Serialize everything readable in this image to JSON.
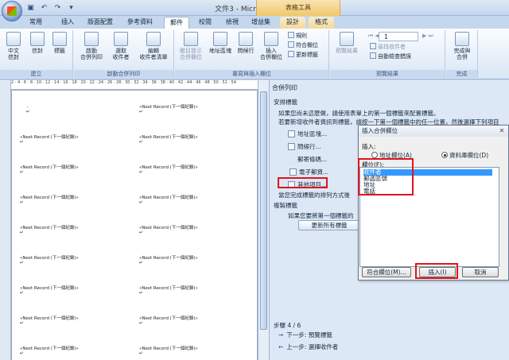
{
  "window": {
    "title": "文件3 - Microsoft Word",
    "context_tools": "表格工具"
  },
  "quick_access": [
    "save-icon",
    "undo-icon",
    "redo-icon",
    "dropdown-icon"
  ],
  "tabs": [
    {
      "label": "常用"
    },
    {
      "label": "插入"
    },
    {
      "label": "版面配置"
    },
    {
      "label": "參考資料"
    },
    {
      "label": "郵件",
      "active": true
    },
    {
      "label": "校閱"
    },
    {
      "label": "檢視"
    },
    {
      "label": "增益集"
    },
    {
      "label": "設計",
      "contextual": true
    },
    {
      "label": "格式",
      "contextual": true
    }
  ],
  "ribbon": {
    "groups": [
      {
        "label": "建立",
        "buttons": [
          "中文\n信封",
          "信封",
          "標籤"
        ]
      },
      {
        "label": "啟動合併列印",
        "buttons": [
          "啟動\n合併列印",
          "選取\n收件者",
          "編輯\n收件者清單"
        ]
      },
      {
        "label": "書寫與插入欄位",
        "buttons": [
          "醒目提示\n合併欄位",
          "地址區塊",
          "問候行",
          "插入\n合併欄位"
        ],
        "small": [
          "規則",
          "符合欄位",
          "更新標籤"
        ]
      },
      {
        "label": "預覽結果",
        "buttons": [
          "預覽結果"
        ],
        "small": [
          "尋找收件者",
          "自動檢查錯誤"
        ],
        "record": "1"
      },
      {
        "label": "完成",
        "buttons": [
          "完成與\n合併"
        ]
      }
    ]
  },
  "ruler": "2 · 4 · 6 · 8 · 10 · 12 · 14 · 16 · 18 · 20 · 22 · 24 · 26 · 28 · 30 · 32 · 34 · 36 · 38 · 40 · 42 · 44 · 46 · 48 · 50 · 52 · 54",
  "document": {
    "next_record_text": "«Next Record (下一個紀錄)»",
    "cell_mark": "¸",
    "paragraph_mark": "↵"
  },
  "task_pane": {
    "title": "合併列印",
    "section_arrange": "安排標籤",
    "intro_line1": "如果您尚未這麼做，請使用表單上的第一個標籤來配置標籤。",
    "intro_line2": "若要新增收件者資訊到標籤，請按一下第一個標籤中的任一位置，然後選擇下列項目",
    "links": [
      "地址區塊...",
      "問候行...",
      "郵寄條碼...",
      "電子郵資...",
      "其他項目..."
    ],
    "finish_text": "當您完成標籤的排列方式後",
    "section_copy": "複製標籤",
    "copy_text": "如果您要將第一個標籤的",
    "update_button": "更新所有標籤",
    "step": "步驟 4 / 6",
    "next_step": "下一步: 預覽標籤",
    "prev_step": "上一步: 選擇收件者"
  },
  "dialog": {
    "title": "插入合併欄位",
    "insert_label": "插入:",
    "radio_address": "地址欄位(A)",
    "radio_database": "資料庫欄位(D)",
    "fields_label": "欄位(F):",
    "fields": [
      "收件者",
      "郵遞區號",
      "地址",
      "電話"
    ],
    "selected_field": "收件者",
    "match_button": "符合欄位(M)...",
    "insert_button": "插入(I)",
    "cancel_button": "取消"
  }
}
